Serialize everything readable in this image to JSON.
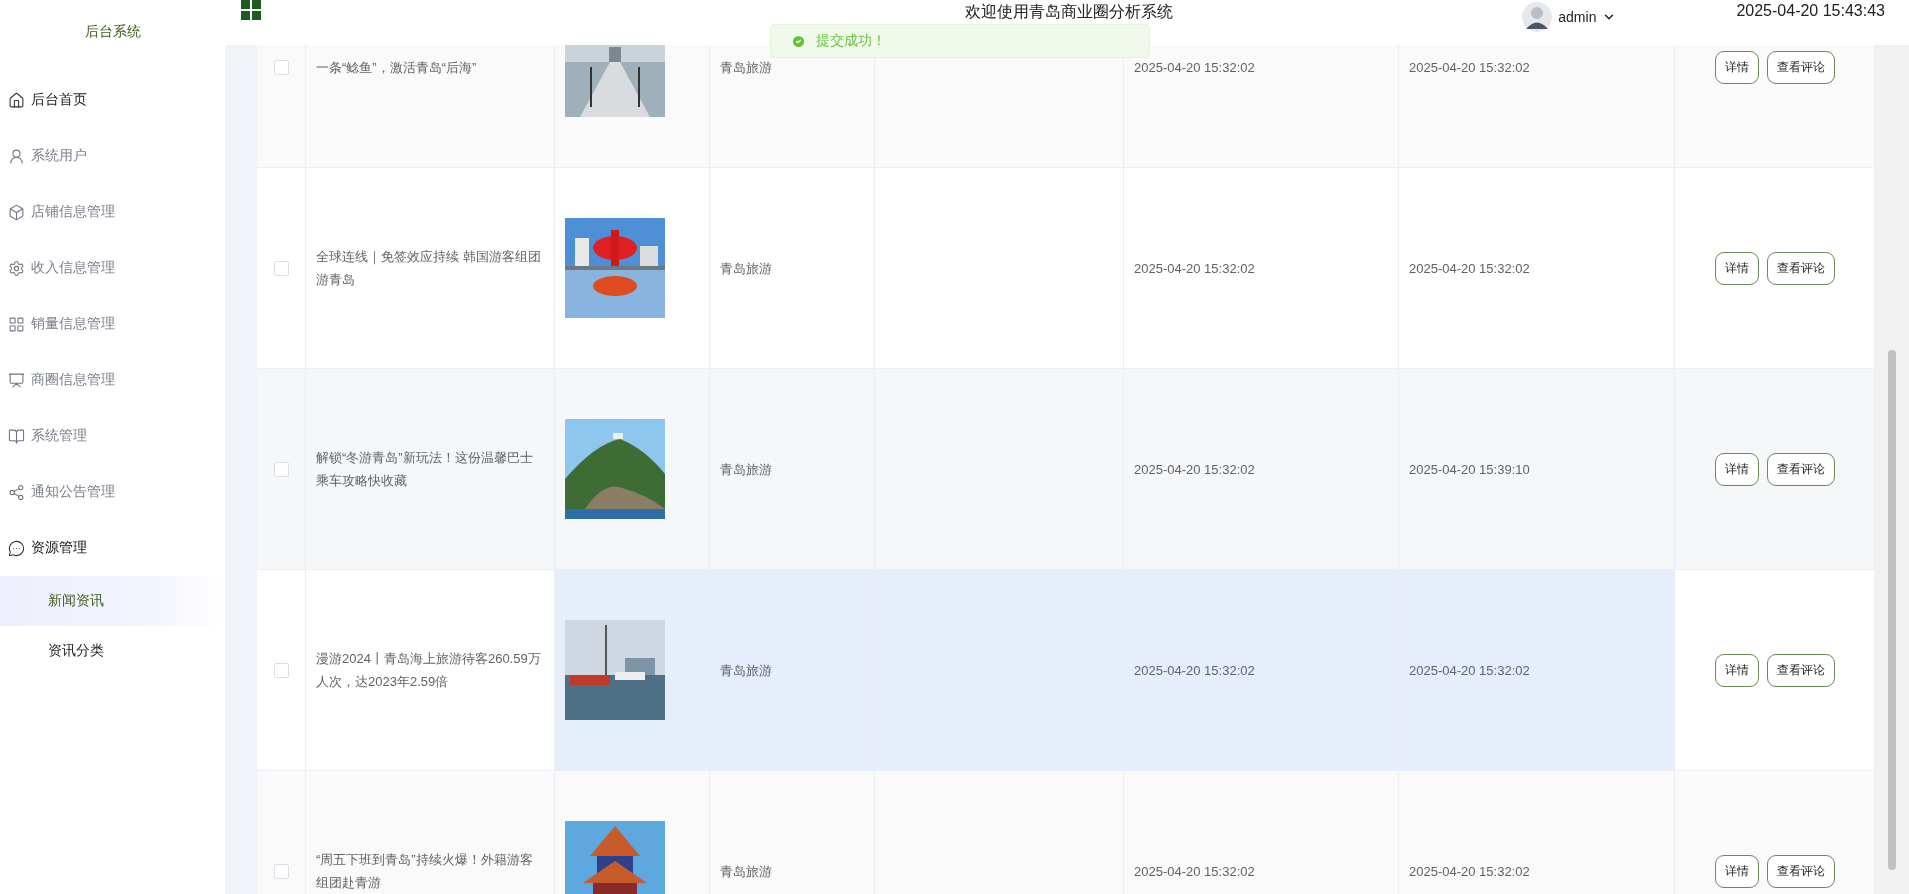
{
  "sidebar": {
    "title": "后台系统",
    "items": [
      {
        "label": "后台首页",
        "kind": "link",
        "expanded": false
      },
      {
        "label": "系统用户",
        "kind": "submenu",
        "expanded": false
      },
      {
        "label": "店铺信息管理",
        "kind": "submenu",
        "expanded": false
      },
      {
        "label": "收入信息管理",
        "kind": "submenu",
        "expanded": false
      },
      {
        "label": "销量信息管理",
        "kind": "submenu",
        "expanded": false
      },
      {
        "label": "商圈信息管理",
        "kind": "submenu",
        "expanded": false
      },
      {
        "label": "系统管理",
        "kind": "submenu",
        "expanded": false
      },
      {
        "label": "通知公告管理",
        "kind": "submenu",
        "expanded": false
      },
      {
        "label": "资源管理",
        "kind": "submenu",
        "expanded": true,
        "children": [
          {
            "label": "新闻资讯",
            "selected": true
          },
          {
            "label": "资讯分类",
            "selected": false
          }
        ]
      }
    ]
  },
  "header": {
    "title": "欢迎使用青岛商业圈分析系统",
    "user": "admin",
    "datetime": "2025-04-20 15:43:43"
  },
  "toast": {
    "message": "提交成功！"
  },
  "table": {
    "rows": [
      {
        "checked": false,
        "highlighted": false,
        "title": "一条“鲶鱼”，激活青岛“后海”",
        "category": "青岛旅游",
        "created": "2025-04-20 15:32:02",
        "updated": "2025-04-20 15:32:02",
        "actions": [
          "详情",
          "查看评论"
        ]
      },
      {
        "checked": false,
        "highlighted": false,
        "title": "全球连线｜免签效应持续 韩国游客组团游青岛",
        "category": "青岛旅游",
        "created": "2025-04-20 15:32:02",
        "updated": "2025-04-20 15:32:02",
        "actions": [
          "详情",
          "查看评论"
        ]
      },
      {
        "checked": false,
        "highlighted": false,
        "title": "解锁“冬游青岛”新玩法！这份温馨巴士乘车攻略快收藏",
        "category": "青岛旅游",
        "created": "2025-04-20 15:32:02",
        "updated": "2025-04-20 15:39:10",
        "actions": [
          "详情",
          "查看评论"
        ]
      },
      {
        "checked": false,
        "highlighted": true,
        "title": "漫游2024丨青岛海上旅游待客260.59万人次，达2023年2.59倍",
        "category": "青岛旅游",
        "created": "2025-04-20 15:32:02",
        "updated": "2025-04-20 15:32:02",
        "actions": [
          "详情",
          "查看评论"
        ]
      },
      {
        "checked": false,
        "highlighted": false,
        "title": "“周五下班到青岛”持续火爆！外籍游客组团赴青游",
        "category": "青岛旅游",
        "created": "2025-04-20 15:32:02",
        "updated": "2025-04-20 15:32:02",
        "actions": [
          "详情",
          "查看评论"
        ]
      }
    ]
  }
}
